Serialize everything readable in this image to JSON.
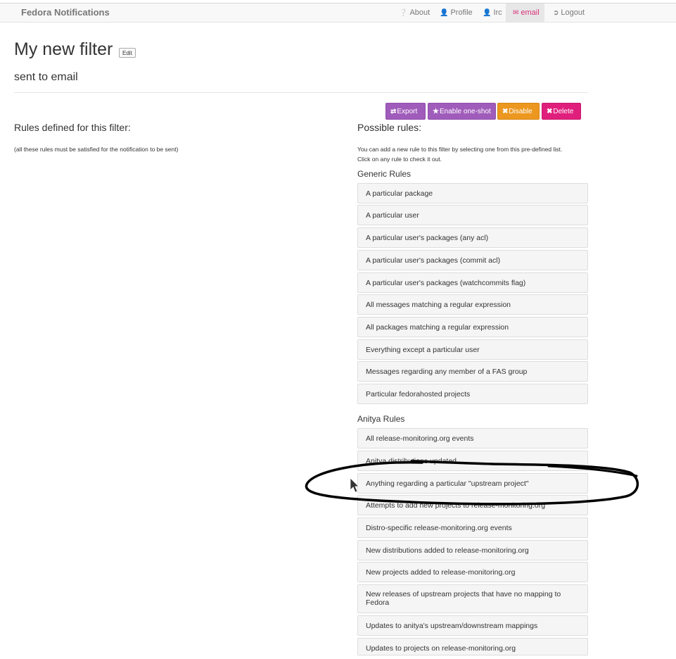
{
  "navbar": {
    "brand": "Fedora Notifications",
    "items": [
      {
        "label": "About",
        "icon": "question-circle-icon"
      },
      {
        "label": "Profile",
        "icon": "user-icon"
      },
      {
        "label": "Irc",
        "icon": "user-icon"
      },
      {
        "label": "email",
        "icon": "envelope-icon",
        "active": true
      },
      {
        "label": "Logout",
        "icon": "logout-icon"
      }
    ]
  },
  "filter": {
    "title": "My new filter",
    "edit_label": "Edit",
    "subtitle": "sent to email"
  },
  "actions": {
    "export": "Export",
    "one_shot": "Enable one-shot",
    "disable": "Disable",
    "delete": "Delete"
  },
  "rules_defined": {
    "heading": "Rules defined for this filter:",
    "note": "(all these rules must be satisfied for the notification to be sent)"
  },
  "possible_rules": {
    "heading": "Possible rules:",
    "help_line1": "You can add a new rule to this filter by selecting one from this pre-defined list.",
    "help_line2": "Click on any rule to check it out.",
    "generic": {
      "heading": "Generic Rules",
      "items": [
        "A particular package",
        "A particular user",
        "A particular user's packages (any acl)",
        "A particular user's packages (commit acl)",
        "A particular user's packages (watchcommits flag)",
        "All messages matching a regular expression",
        "All packages matching a regular expression",
        "Everything except a particular user",
        "Messages regarding any member of a FAS group",
        "Particular fedorahosted projects"
      ]
    },
    "anitya": {
      "heading": "Anitya Rules",
      "items": [
        "All release-monitoring.org events",
        "Anitya distributions updated",
        "Anything regarding a particular \"upstream project\"",
        "Attempts to add new projects to release-monitoring.org",
        "Distro-specific release-monitoring.org events",
        "New distributions added to release-monitoring.org",
        "New projects added to release-monitoring.org",
        "New releases of upstream projects that have no mapping to Fedora",
        "Updates to anitya's upstream/downstream mappings",
        "Updates to projects on release-monitoring.org"
      ]
    }
  },
  "colors": {
    "accent_pink": "#d9327a",
    "purple_button": "#a05cbb",
    "orange_button": "#ec971f",
    "delete_button": "#e01f7d"
  }
}
